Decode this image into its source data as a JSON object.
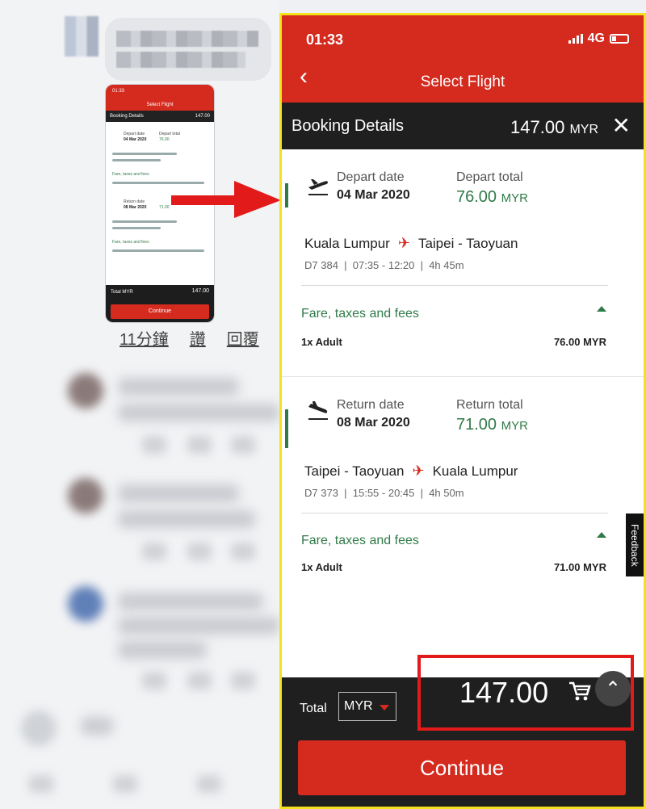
{
  "thread": {
    "timestamp": "11分鐘",
    "like_label": "讚",
    "reply_label": "回覆"
  },
  "thumbnail": {
    "time": "01:33",
    "title": "Select Flight",
    "booking_title": "Booking Details",
    "booking_amount": "147.00",
    "depart_date_label": "Depart date",
    "depart_date": "04 Mar 2020",
    "depart_total_label": "Depart total",
    "depart_total": "76.00",
    "return_date_label": "Return date",
    "return_date": "08 Mar 2020",
    "return_total": "71.00",
    "fare_label": "Fare, taxes and fees",
    "footer_total": "Total",
    "footer_currency": "MYR",
    "footer_amount": "147.00",
    "continue": "Continue"
  },
  "status_bar": {
    "time": "01:33",
    "network": "4G"
  },
  "header": {
    "title": "Select Flight"
  },
  "booking": {
    "title": "Booking Details",
    "amount": "147.00",
    "currency": "MYR"
  },
  "depart": {
    "date_label": "Depart date",
    "date": "04 Mar 2020",
    "total_label": "Depart total",
    "total": "76.00",
    "currency": "MYR",
    "from": "Kuala Lumpur",
    "to": "Taipei - Taoyuan",
    "flight_no": "D7 384",
    "time": "07:35 - 12:20",
    "duration": "4h 45m",
    "fare_label": "Fare, taxes and fees",
    "passenger": "1x Adult",
    "price": "76.00 MYR"
  },
  "return": {
    "date_label": "Return date",
    "date": "08 Mar 2020",
    "total_label": "Return total",
    "total": "71.00",
    "currency": "MYR",
    "from": "Taipei - Taoyuan",
    "to": "Kuala Lumpur",
    "flight_no": "D7 373",
    "time": "15:55 - 20:45",
    "duration": "4h 50m",
    "fare_label": "Fare, taxes and fees",
    "passenger": "1x Adult",
    "price": "71.00 MYR"
  },
  "feedback": "Feedback",
  "footer": {
    "total_label": "Total",
    "currency": "MYR",
    "amount": "147.00",
    "continue_label": "Continue"
  },
  "colors": {
    "brand_red": "#d52a1e",
    "green": "#2f7a48",
    "dark": "#1f1f1f",
    "highlight_border": "#f3e21d",
    "annotation_red": "#e21a1a"
  }
}
